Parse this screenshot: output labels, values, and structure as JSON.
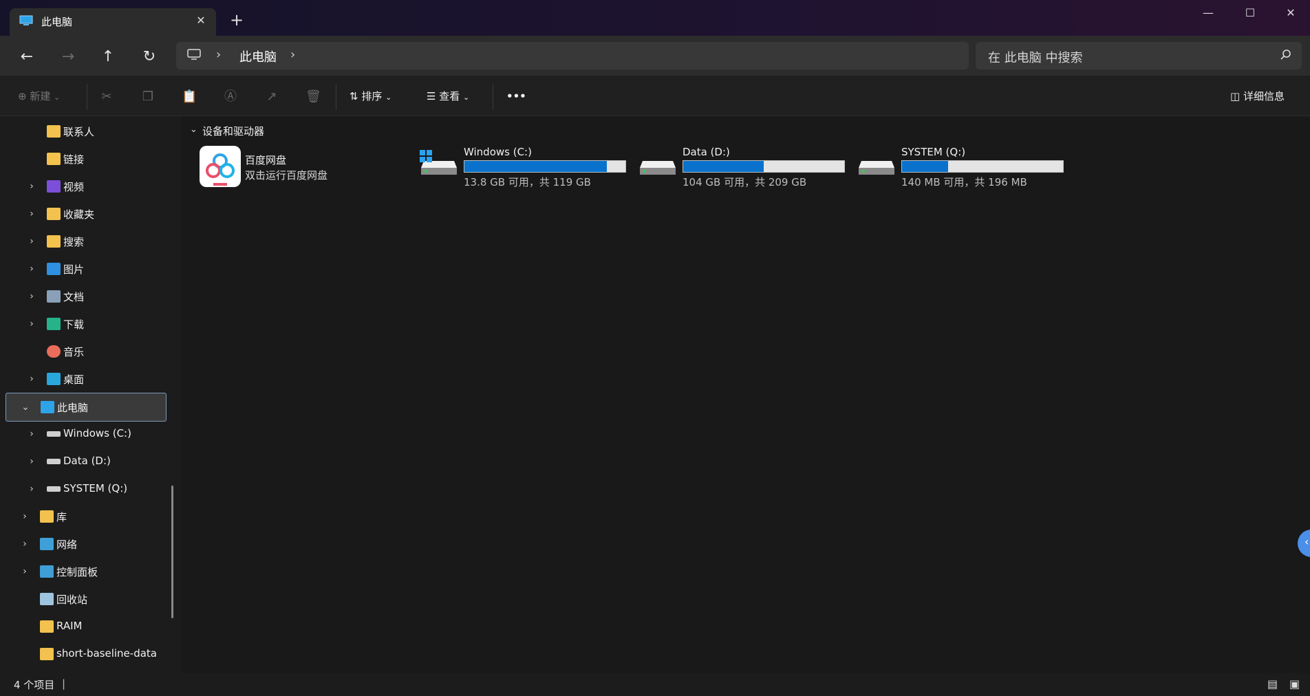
{
  "window": {
    "tab_title": "此电脑",
    "new_tab_icon": "plus-icon",
    "controls": [
      "minimize-icon",
      "maximize-icon",
      "close-icon"
    ]
  },
  "nav": {
    "breadcrumb_root_icon": "computer-icon",
    "breadcrumb": [
      "此电脑"
    ],
    "search_placeholder": "在 此电脑 中搜索"
  },
  "toolbar": {
    "new_label": "新建",
    "sort_label": "排序",
    "view_label": "查看",
    "details_label": "详细信息",
    "icons": [
      "cut-icon",
      "copy-icon",
      "paste-icon",
      "rename-icon",
      "share-icon",
      "delete-icon",
      "more-icon"
    ]
  },
  "sidebar": {
    "items": [
      {
        "label": "联系人",
        "icon": "folder-icon",
        "expandable": false
      },
      {
        "label": "链接",
        "icon": "folder-icon",
        "expandable": false
      },
      {
        "label": "视频",
        "icon": "video-icon",
        "expandable": true
      },
      {
        "label": "收藏夹",
        "icon": "folder-icon",
        "expandable": true
      },
      {
        "label": "搜索",
        "icon": "folder-icon",
        "expandable": true
      },
      {
        "label": "图片",
        "icon": "pictures-icon",
        "expandable": true
      },
      {
        "label": "文档",
        "icon": "documents-icon",
        "expandable": true
      },
      {
        "label": "下载",
        "icon": "download-icon",
        "expandable": true
      },
      {
        "label": "音乐",
        "icon": "music-icon",
        "expandable": false
      },
      {
        "label": "桌面",
        "icon": "desktop-icon",
        "expandable": true
      },
      {
        "label": "此电脑",
        "icon": "computer-icon",
        "expandable": true,
        "selected": true
      },
      {
        "label": "Windows (C:)",
        "icon": "drive-icon",
        "expandable": true
      },
      {
        "label": "Data (D:)",
        "icon": "drive-icon",
        "expandable": true
      },
      {
        "label": "SYSTEM (Q:)",
        "icon": "drive-icon",
        "expandable": true
      },
      {
        "label": "库",
        "icon": "folder-icon",
        "expandable": true
      },
      {
        "label": "网络",
        "icon": "network-icon",
        "expandable": true
      },
      {
        "label": "控制面板",
        "icon": "control-panel-icon",
        "expandable": true
      },
      {
        "label": "回收站",
        "icon": "recycle-bin-icon",
        "expandable": false
      },
      {
        "label": "RAIM",
        "icon": "folder-icon",
        "expandable": false
      },
      {
        "label": "short-baseline-data",
        "icon": "folder-icon",
        "expandable": false
      }
    ]
  },
  "content": {
    "group_title": "设备和驱动器",
    "app": {
      "name": "百度网盘",
      "subtitle": "双击运行百度网盘",
      "icon": "baidu-netdisk-icon"
    },
    "drives": [
      {
        "name": "Windows (C:)",
        "info": "13.8 GB 可用，共 119 GB",
        "used_fraction": 0.884,
        "icon": "windows-drive-icon"
      },
      {
        "name": "Data (D:)",
        "info": "104 GB 可用，共 209 GB",
        "used_fraction": 0.502,
        "icon": "drive-icon"
      },
      {
        "name": "SYSTEM (Q:)",
        "info": "140 MB 可用，共 196 MB",
        "used_fraction": 0.286,
        "icon": "drive-icon"
      }
    ]
  },
  "status": {
    "count_text": "4 个项目",
    "view_icons": [
      "details-view-icon",
      "tiles-view-icon"
    ]
  },
  "colors": {
    "accent": "#0a72cc",
    "background": "#191919",
    "folder": "#f2c14e"
  }
}
